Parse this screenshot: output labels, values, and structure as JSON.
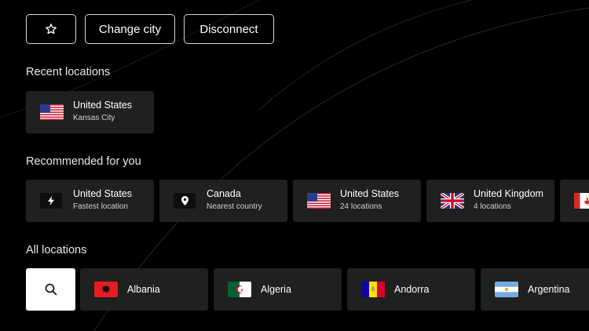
{
  "toolbar": {
    "change_city_label": "Change city",
    "disconnect_label": "Disconnect"
  },
  "recent": {
    "title": "Recent locations",
    "items": [
      {
        "country": "United States",
        "subtitle": "Kansas City",
        "flag": "us-flag"
      }
    ]
  },
  "recommended": {
    "title": "Recommended for you",
    "items": [
      {
        "country": "United States",
        "subtitle": "Fastest location",
        "icon": "lightning-icon"
      },
      {
        "country": "Canada",
        "subtitle": "Nearest country",
        "icon": "location-pin-icon"
      },
      {
        "country": "United States",
        "subtitle": "24 locations",
        "flag": "us-flag"
      },
      {
        "country": "United Kingdom",
        "subtitle": "4 locations",
        "flag": "uk-flag"
      },
      {
        "country": "",
        "subtitle": "",
        "flag": "canada-flag"
      }
    ]
  },
  "all_locations": {
    "title": "All locations",
    "items": [
      {
        "country": "Albania",
        "flag": "albania-flag"
      },
      {
        "country": "Algeria",
        "flag": "algeria-flag"
      },
      {
        "country": "Andorra",
        "flag": "andorra-flag"
      },
      {
        "country": "Argentina",
        "flag": "argentina-flag"
      }
    ]
  },
  "colors": {
    "background": "#000000",
    "card": "#1f2020",
    "button_border": "#d8d8d8"
  }
}
